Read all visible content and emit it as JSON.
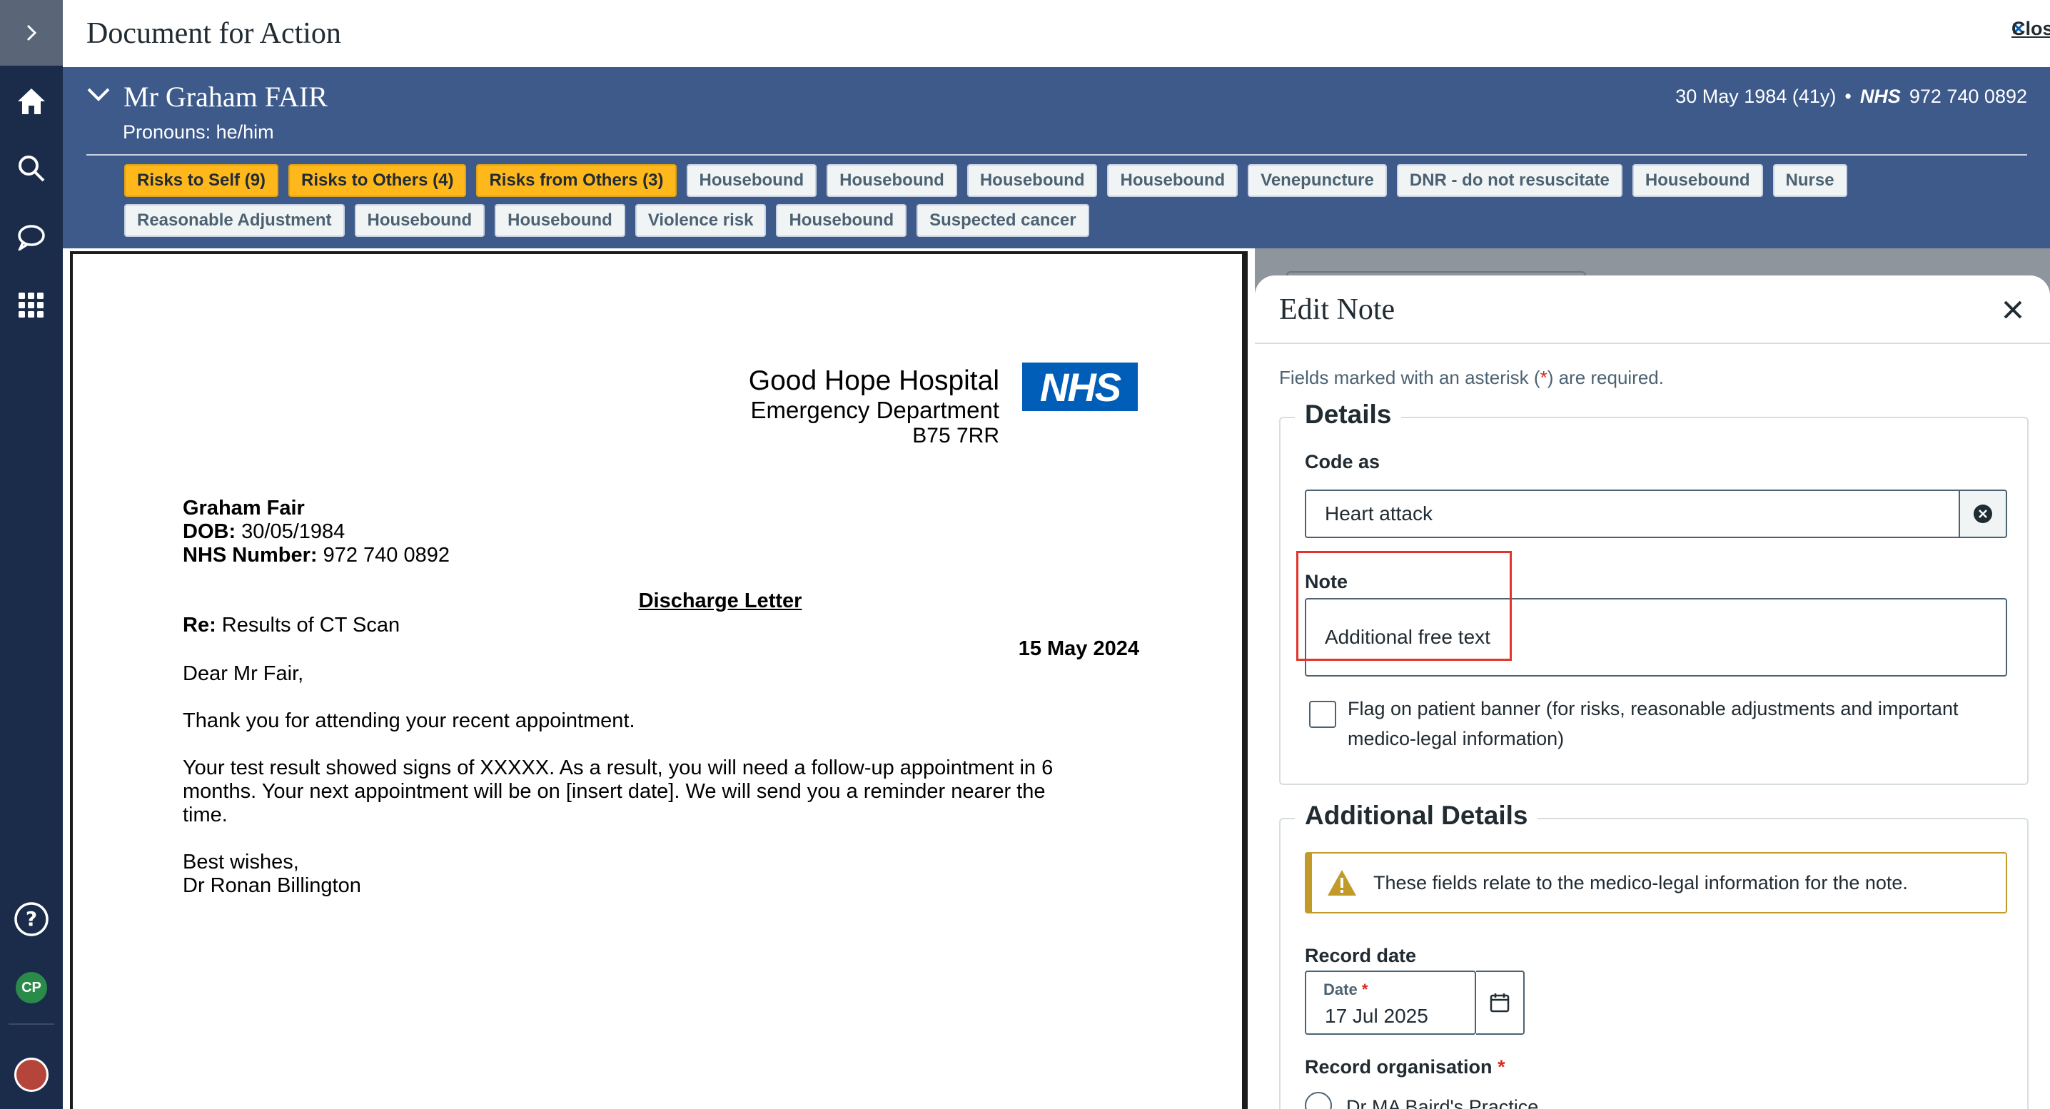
{
  "nav": {
    "expand_label": "›",
    "avatar_initials": "CP"
  },
  "header": {
    "title": "Document for Action",
    "close_label": "Close"
  },
  "patient": {
    "name": "Mr Graham FAIR",
    "pronouns": "Pronouns: he/him",
    "dob_age": "30 May 1984 (41y)",
    "separator": "•",
    "nhs_label": "NHS",
    "nhs_number": "972 740 0892"
  },
  "flags_row1": [
    {
      "label": "Risks to Self (9)",
      "kind": "risk"
    },
    {
      "label": "Risks to Others (4)",
      "kind": "risk"
    },
    {
      "label": "Risks from Others (3)",
      "kind": "risk"
    },
    {
      "label": "Housebound",
      "kind": "info"
    },
    {
      "label": "Housebound",
      "kind": "info"
    },
    {
      "label": "Housebound",
      "kind": "info"
    },
    {
      "label": "Housebound",
      "kind": "info"
    },
    {
      "label": "Venepuncture",
      "kind": "info"
    },
    {
      "label": "DNR - do not resuscitate",
      "kind": "info"
    },
    {
      "label": "Housebound",
      "kind": "info"
    },
    {
      "label": "Nurse",
      "kind": "info"
    }
  ],
  "flags_row2": [
    {
      "label": "Reasonable Adjustment",
      "kind": "info"
    },
    {
      "label": "Housebound",
      "kind": "info"
    },
    {
      "label": "Housebound",
      "kind": "info"
    },
    {
      "label": "Violence risk",
      "kind": "info"
    },
    {
      "label": "Housebound",
      "kind": "info"
    },
    {
      "label": "Suspected cancer",
      "kind": "info"
    }
  ],
  "letter": {
    "hospital": "Good Hope Hospital",
    "department": "Emergency Department",
    "postcode": "B75 7RR",
    "logo_text": "NHS",
    "patient_name": "Graham Fair",
    "dob_label": "DOB:",
    "dob_value": "30/05/1984",
    "nhs_label": "NHS Number:",
    "nhs_value": "972 740 0892",
    "doc_title": "Discharge Letter",
    "re_label": "Re:",
    "re_value": "Results of CT Scan",
    "date": "15 May 2024",
    "salutation": "Dear Mr Fair,",
    "para1": "Thank you for attending your recent appointment.",
    "para2_line1": "Your test result showed signs of XXXXX. As a result, you will need a follow-up appointment in 6",
    "para2_line2": "months. Your next appointment will be on [insert date]. We will send you a reminder nearer the",
    "para2_line3": "time.",
    "signoff": "Best wishes,",
    "signature": "Dr Ronan Billington"
  },
  "panel": {
    "title": "Edit Note",
    "required_hint_pre": "Fields marked with an asterisk (",
    "asterisk": "*",
    "required_hint_post": ") are required.",
    "details_legend": "Details",
    "code_label": "Code as",
    "code_value": "Heart attack",
    "note_label": "Note",
    "note_value": "Additional free text",
    "flag_text_line1": "Flag on patient banner (for risks, reasonable adjustments and important",
    "flag_text_line2": "medico-legal information)",
    "additional_legend": "Additional Details",
    "warning_text": "These fields relate to the medico-legal information for the note.",
    "record_date_label": "Record date",
    "date_small_label": "Date",
    "date_value": "17 Jul 2025",
    "record_org_label": "Record organisation",
    "org_option": "Dr MA Baird's Practice"
  },
  "colors": {
    "nav": "#1b2b4a",
    "banner": "#3d5a8a",
    "risk_chip": "#ffb81c",
    "link": "#005eb8",
    "nhs_blue": "#005eb8",
    "highlight": "#e4342a"
  }
}
